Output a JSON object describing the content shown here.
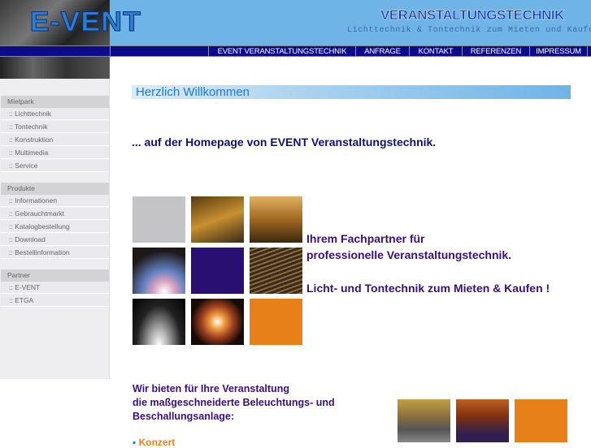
{
  "header": {
    "logo": "E-VENT",
    "brand": "VERANSTALTUNGSTECHNIK",
    "tagline": "Lichttechnik & Tontechnik zum Mieten und Kaufen"
  },
  "nav": [
    {
      "label": "EVENT VERANSTALTUNGSTECHNIK"
    },
    {
      "label": "ANFRAGE"
    },
    {
      "label": "KONTAKT"
    },
    {
      "label": "REFERENZEN"
    },
    {
      "label": "IMPRESSUM"
    }
  ],
  "sidebar": {
    "sections": [
      {
        "title": "Mietpark",
        "items": [
          ":: Lichttechnik",
          ":: Tontechnik",
          ":: Konstruktion",
          ":: Multimedia",
          ":: Service"
        ]
      },
      {
        "title": "Produkte",
        "items": [
          ":: Informationen",
          ":: Gebrauchtmarkt",
          ":: Katalogbestellung",
          ":: Download",
          ":: Bestellinformation"
        ]
      },
      {
        "title": "Partner",
        "items": [
          ":: E-VENT",
          ":: ETGA"
        ]
      }
    ]
  },
  "main": {
    "welcome": "Herzlich Willkommen",
    "intro": "... auf der Homepage von EVENT Veranstaltungstechnik.",
    "partner1": "Ihrem Fachpartner für",
    "partner2": "professionelle Veranstaltungstechnik.",
    "partner3": "Licht- und Tontechnik zum Mieten & Kaufen !",
    "offer1": "Wir bieten für Ihre Veranstaltung",
    "offer2": "die maßgeschneiderte Beleuchtungs- und",
    "offer3": "Beschallungsanlage:",
    "list_item": "Konzert"
  },
  "colors": {
    "header": "#6fb4e6",
    "nav": "#0b0b8c",
    "text": "#3a0f7a",
    "orange": "#e8801a"
  }
}
